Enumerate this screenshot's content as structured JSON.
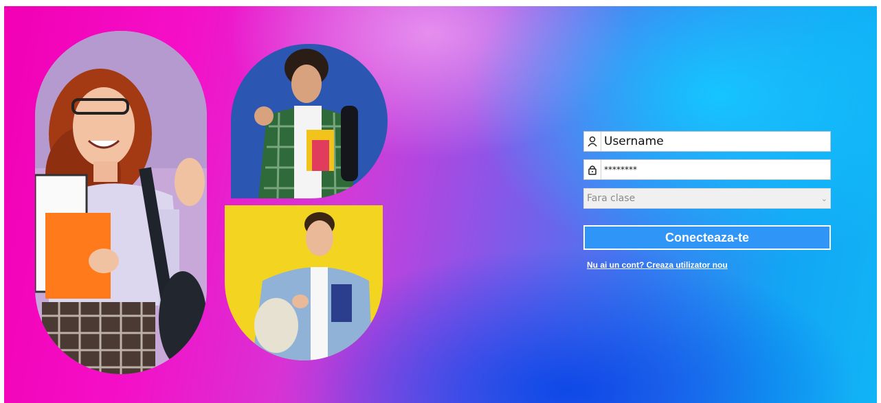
{
  "login": {
    "username_value": "Username",
    "password_value": "********",
    "class_select_value": "Fara clase",
    "connect_label": "Conecteaza-te",
    "create_account_link": "Nu ai un cont? Creaza utilizator nou"
  },
  "icons": {
    "username": "user-icon",
    "password": "lock-icon",
    "select": "chevron-down-icon"
  },
  "colors": {
    "button": "#2f95f7",
    "magenta": "#f200b4",
    "cyan": "#12b4f6"
  }
}
